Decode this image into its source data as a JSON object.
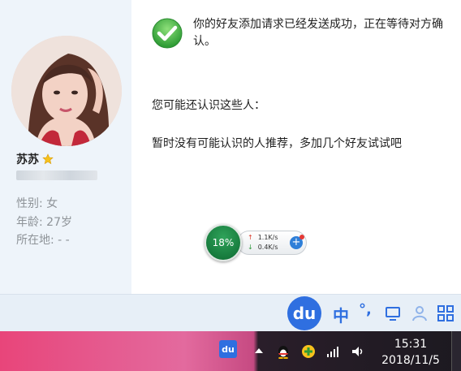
{
  "profile": {
    "name": "苏苏",
    "gender": "性别: 女",
    "age": "年龄: 27岁",
    "location": "所在地:  -     -"
  },
  "main": {
    "success_message": "你的好友添加请求已经发送成功，正在等待对方确认。",
    "maybe_know": "您可能还认识这些人：",
    "no_recommend": "暂时没有可能认识的人推荐，多加几个好友试试吧"
  },
  "net_widget": {
    "percent": "18%",
    "upload": "1.1K/s",
    "download": "0.4K/s"
  },
  "ime": {
    "logo": "du",
    "mode": "中",
    "punct": "°,"
  },
  "taskbar": {
    "tray_du": "du",
    "time": "15:31",
    "date": "2018/11/5"
  },
  "colors": {
    "accent_blue": "#2f6fe0",
    "success_green": "#3bb64a"
  }
}
